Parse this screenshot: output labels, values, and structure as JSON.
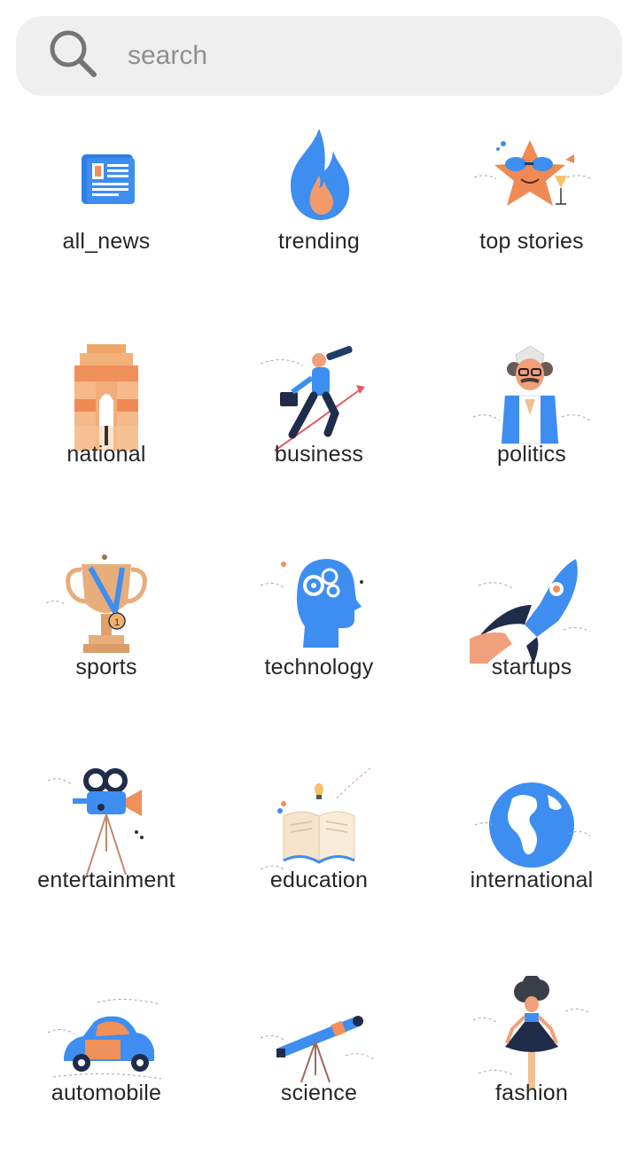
{
  "search": {
    "placeholder": "search",
    "icon": "search-icon"
  },
  "colors": {
    "accent": "#3d8ef0",
    "orange": "#f0905a",
    "search_bg": "#efefef",
    "text": "#262626"
  },
  "categories": [
    {
      "label": "all_news",
      "icon": "newspaper-icon"
    },
    {
      "label": "trending",
      "icon": "flame-icon"
    },
    {
      "label": "top stories",
      "icon": "star-sunglasses-icon"
    },
    {
      "label": "national",
      "icon": "india-gate-icon"
    },
    {
      "label": "business",
      "icon": "businessman-telescope-icon"
    },
    {
      "label": "politics",
      "icon": "politician-icon"
    },
    {
      "label": "sports",
      "icon": "trophy-icon"
    },
    {
      "label": "technology",
      "icon": "head-gears-icon"
    },
    {
      "label": "startups",
      "icon": "rocket-icon"
    },
    {
      "label": "entertainment",
      "icon": "movie-camera-icon"
    },
    {
      "label": "education",
      "icon": "open-book-icon"
    },
    {
      "label": "international",
      "icon": "globe-icon"
    },
    {
      "label": "automobile",
      "icon": "car-icon"
    },
    {
      "label": "science",
      "icon": "telescope-icon"
    },
    {
      "label": "fashion",
      "icon": "fashion-model-icon"
    }
  ]
}
